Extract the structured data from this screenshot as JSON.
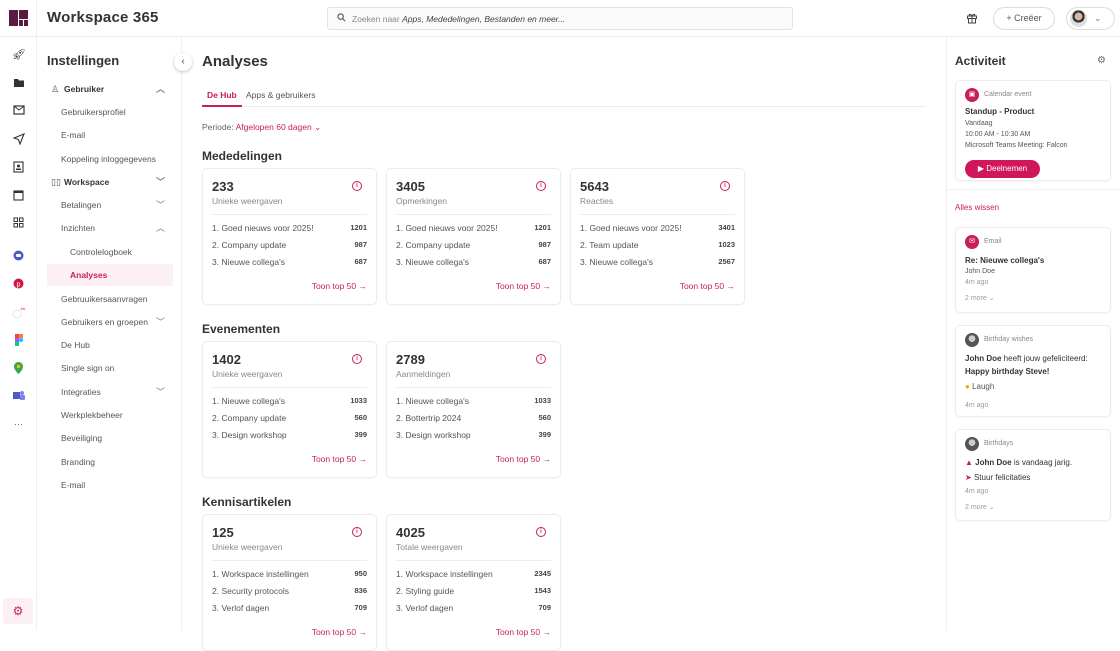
{
  "header": {
    "app_title": "Workspace 365",
    "search_placeholder_prefix": "Zoeken naar ",
    "search_placeholder_emphasis": "Apps, Mededelingen, Bestanden en meer...",
    "create_label": "+ Creëer",
    "icons": [
      "logo-icon",
      "search-icon",
      "gift-icon",
      "avatar",
      "chevron-down-icon"
    ]
  },
  "rail": {
    "icons": [
      "rocket-icon",
      "folder-icon",
      "mail-icon",
      "send-icon",
      "contacts-icon",
      "calendar-icon",
      "apps-grid-icon",
      "app-chat-icon",
      "app-pinterest-icon",
      "app-unknown-icon",
      "app-figma-icon",
      "app-maps-icon",
      "app-teams-icon",
      "more-icon",
      "settings-icon"
    ]
  },
  "settings": {
    "title": "Instellingen",
    "items": [
      {
        "label": "Gebruiker",
        "type": "group",
        "chevron": "up"
      },
      {
        "label": "Gebruikersprofiel",
        "type": "l1"
      },
      {
        "label": "E-mail",
        "type": "l1"
      },
      {
        "label": "Koppeling inloggegevens",
        "type": "l1"
      },
      {
        "label": "Workspace",
        "type": "group",
        "chevron": "down"
      },
      {
        "label": "Betalingen",
        "type": "l1",
        "chevron": "down"
      },
      {
        "label": "Inzichten",
        "type": "l1",
        "chevron": "up"
      },
      {
        "label": "Controlelogboek",
        "type": "l2"
      },
      {
        "label": "Analyses",
        "type": "l2",
        "active": true
      },
      {
        "label": "Gebruuikersaanvragen",
        "type": "l1"
      },
      {
        "label": "Gebruikers en groepen",
        "type": "l1",
        "chevron": "down"
      },
      {
        "label": "De Hub",
        "type": "l1"
      },
      {
        "label": "Single sign on",
        "type": "l1"
      },
      {
        "label": "Integraties",
        "type": "l1",
        "chevron": "down"
      },
      {
        "label": "Werkplekbeheer",
        "type": "l1"
      },
      {
        "label": "Beveiliging",
        "type": "l1"
      },
      {
        "label": "Branding",
        "type": "l1"
      },
      {
        "label": "E-mail",
        "type": "l1"
      }
    ]
  },
  "main": {
    "title": "Analyses",
    "tabs": [
      {
        "label": "De Hub",
        "active": true
      },
      {
        "label": "Apps & gebruikers"
      }
    ],
    "period_label": "Periode:",
    "period_value": "Afgelopen 60 dagen",
    "more_label": "Toon top 50",
    "sections": [
      {
        "title": "Mededelingen",
        "cards": [
          {
            "value": "233",
            "label": "Unieke weergaven",
            "rows": [
              {
                "name": "1. Goed nieuws voor 2025!",
                "value": "1201"
              },
              {
                "name": "2. Company update",
                "value": "987"
              },
              {
                "name": "3. Nieuwe collega's",
                "value": "687"
              }
            ]
          },
          {
            "value": "3405",
            "label": "Opmerkingen",
            "rows": [
              {
                "name": "1. Goed nieuws voor 2025!",
                "value": "1201"
              },
              {
                "name": "2. Company update",
                "value": "987"
              },
              {
                "name": "3. Nieuwe collega's",
                "value": "687"
              }
            ]
          },
          {
            "value": "5643",
            "label": "Reacties",
            "rows": [
              {
                "name": "1. Goed nieuws voor 2025!",
                "value": "3401"
              },
              {
                "name": "2. Team update",
                "value": "1023"
              },
              {
                "name": "3. Nieuwe collega's",
                "value": "2567"
              }
            ]
          }
        ]
      },
      {
        "title": "Evenementen",
        "cards": [
          {
            "value": "1402",
            "label": "Unieke weergaven",
            "rows": [
              {
                "name": "1. Nieuwe collega's",
                "value": "1033"
              },
              {
                "name": "2. Company update",
                "value": "560"
              },
              {
                "name": "3. Design workshop",
                "value": "399"
              }
            ]
          },
          {
            "value": "2789",
            "label": "Aanmeldingen",
            "rows": [
              {
                "name": "1. Nieuwe collega's",
                "value": "1033"
              },
              {
                "name": "2. Bottertrip 2024",
                "value": "560"
              },
              {
                "name": "3. Design workshop",
                "value": "399"
              }
            ]
          }
        ]
      },
      {
        "title": "Kennisartikelen",
        "cards": [
          {
            "value": "125",
            "label": "Unieke weergaven",
            "rows": [
              {
                "name": "1. Workspace instellingen",
                "value": "950"
              },
              {
                "name": "2. Security protocols",
                "value": "836"
              },
              {
                "name": "3. Verlof dagen",
                "value": "709"
              }
            ]
          },
          {
            "value": "4025",
            "label": "Totale weergaven",
            "rows": [
              {
                "name": "1. Workspace instellingen",
                "value": "2345"
              },
              {
                "name": "2. Styling guide",
                "value": "1543"
              },
              {
                "name": "3. Verlof dagen",
                "value": "709"
              }
            ]
          }
        ]
      }
    ]
  },
  "activity": {
    "title": "Activiteit",
    "clear_all": "Alles wissen",
    "calendar": {
      "kind": "Calendar event",
      "title": "Standup - Product",
      "day": "Vandaag",
      "time": "10:00 AM - 10:30 AM",
      "location": "Microsoft Teams Meeting: Falcon",
      "join_label": "Deelnemen"
    },
    "email": {
      "kind": "Email",
      "title": "Re: Nieuwe collega's",
      "from": "John Doe",
      "ago": "4m ago",
      "more": "2 more"
    },
    "wishes": {
      "kind": "Birthday wishes",
      "name": "John Doe",
      "text": " heeft jouw gefeliciteerd:",
      "message": "Happy birthday Steve!",
      "reaction": "Laugh",
      "ago": "4m ago"
    },
    "birthdays": {
      "kind": "Birthdays",
      "name": "John Doe",
      "text": " is vandaag jarig.",
      "action": "Stuur felicitaties",
      "ago": "4m ago",
      "more": "2 more"
    }
  },
  "colors": {
    "accent": "#c81e5b",
    "brand": "#5b1a44"
  }
}
